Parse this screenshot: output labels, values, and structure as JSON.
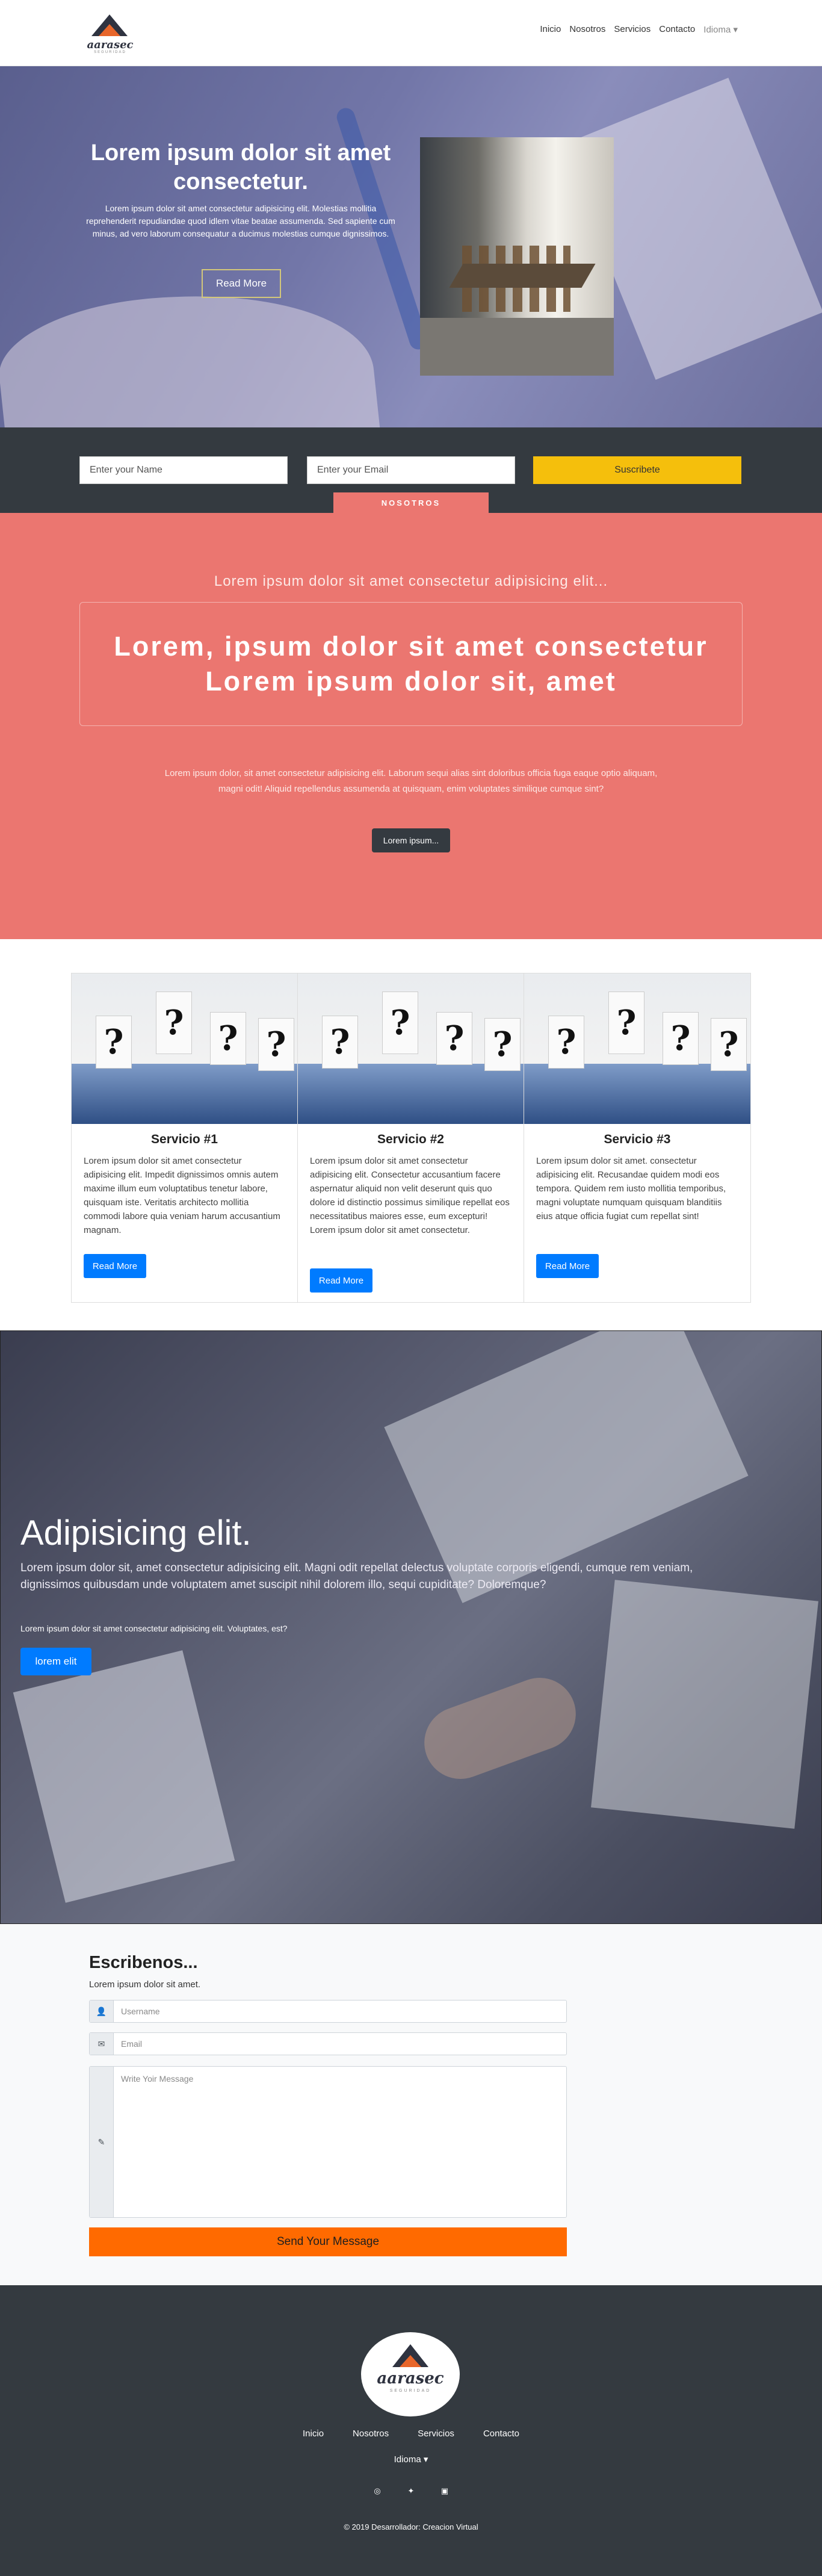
{
  "brand": {
    "name": "aarasec",
    "tagline": "SEGURIDAD"
  },
  "nav": {
    "items": [
      "Inicio",
      "Nosotros",
      "Servicios",
      "Contacto"
    ],
    "lang": "Idioma ▾"
  },
  "hero": {
    "title": "Lorem ipsum dolor sit amet consectetur.",
    "text": "Lorem ipsum dolor sit amet consectetur adipisicing elit. Molestias mollitia reprehenderit repudiandae quod idlem vitae beatae assumenda. Sed sapiente cum minus, ad vero laborum consequatur a ducimus molestias cumque dignissimos.",
    "button": "Read More"
  },
  "subscribe": {
    "name_placeholder": "Enter your Name",
    "email_placeholder": "Enter your Email",
    "button": "Suscribete"
  },
  "about": {
    "tab": "NOSOTROS",
    "lead": "Lorem ipsum dolor sit amet consectetur adipisicing elit...",
    "headline_1": "Lorem, ipsum dolor sit amet consectetur",
    "headline_2": "Lorem ipsum dolor sit, amet",
    "text": "Lorem ipsum dolor, sit amet consectetur adipisicing elit. Laborum sequi alias sint doloribus officia fuga eaque optio aliquam, magni odit! Aliquid repellendus assumenda at quisquam, enim voluptates similique cumque sint?",
    "button": "Lorem ipsum..."
  },
  "services": [
    {
      "title": "Servicio #1",
      "text": "Lorem ipsum dolor sit amet consectetur adipisicing elit. Impedit dignissimos omnis autem maxime illum eum voluptatibus tenetur labore, quisquam iste. Veritatis architecto mollitia commodi labore quia veniam harum accusantium magnam.",
      "button": "Read More"
    },
    {
      "title": "Servicio #2",
      "text": "Lorem ipsum dolor sit amet consectetur adipisicing elit. Consectetur accusantium facere aspernatur aliquid non velit deserunt quis quo dolore id distinctio possimus similique repellat eos necessitatibus maiores esse, eum excepturi! Lorem ipsum dolor sit amet consectetur.",
      "button": "Read More"
    },
    {
      "title": "Servicio #3",
      "text": "Lorem ipsum dolor sit amet. consectetur adipisicing elit. Recusandae quidem modi eos tempora. Quidem rem iusto mollitia temporibus, magni voluptate numquam quisquam blanditiis eius atque officia fugiat cum repellat sint!",
      "button": "Read More"
    }
  ],
  "feature": {
    "title": "Adipisicing elit.",
    "text": "Lorem ipsum dolor sit, amet consectetur adipisicing elit. Magni odit repellat delectus voluptate corporis eligendi, cumque rem veniam, dignissimos quibusdam unde voluptatem amet suscipit nihil dolorem illo, sequi cupiditate? Doloremque?",
    "subtext": "Lorem ipsum dolor sit amet consectetur adipisicing elit. Voluptates, est?",
    "button": "lorem elit"
  },
  "contact": {
    "title": "Escribenos...",
    "lead": "Lorem ipsum dolor sit amet.",
    "username_placeholder": "Username",
    "email_placeholder": "Email",
    "message_placeholder": "Write Yoir Message",
    "button": "Send Your Message"
  },
  "footer": {
    "links": [
      "Inicio",
      "Nosotros",
      "Servicios",
      "Contacto"
    ],
    "lang": "Idioma ▾",
    "social": [
      "instagram-icon",
      "twitter-icon",
      "facebook-icon"
    ],
    "copyright": "© 2019 Desarrollador: Creacion Virtual"
  },
  "colors": {
    "dark": "#343a40",
    "coral": "#eb7670",
    "yellow": "#f5bf0c",
    "blue": "#007bff",
    "orange": "#ff6a00"
  }
}
